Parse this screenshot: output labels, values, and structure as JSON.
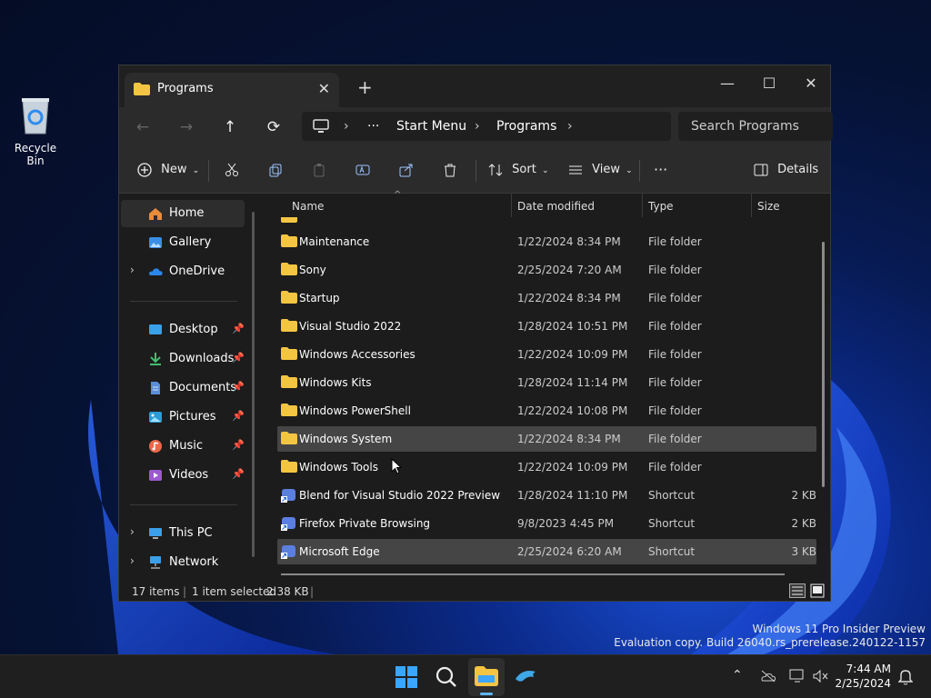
{
  "desktop": {
    "recycle_bin_label": "Recycle Bin",
    "watermark_line1": "Windows 11 Pro Insider Preview",
    "watermark_line2": "Evaluation copy. Build 26040.rs_prerelease.240122-1157"
  },
  "window": {
    "tab_title": "Programs",
    "tab_close": "✕",
    "new_tab": "+",
    "minimize": "—",
    "maximize": "☐",
    "close": "✕"
  },
  "nav": {
    "back": "←",
    "forward": "→",
    "up": "↑",
    "refresh": "⟳",
    "breadcrumb_more": "···",
    "breadcrumb": [
      "Start Menu",
      "Programs"
    ],
    "search_placeholder": "Search Programs"
  },
  "toolbar": {
    "new_label": "New",
    "sort_label": "Sort",
    "view_label": "View",
    "more_label": "···",
    "details_label": "Details"
  },
  "sidebar": {
    "items": [
      {
        "label": "Home",
        "icon": "home-icon"
      },
      {
        "label": "Gallery",
        "icon": "gallery-icon"
      },
      {
        "label": "OneDrive",
        "icon": "onedrive-icon"
      },
      {
        "label": "Desktop",
        "icon": "desktop-icon"
      },
      {
        "label": "Downloads",
        "icon": "downloads-icon"
      },
      {
        "label": "Documents",
        "icon": "documents-icon"
      },
      {
        "label": "Pictures",
        "icon": "pictures-icon"
      },
      {
        "label": "Music",
        "icon": "music-icon"
      },
      {
        "label": "Videos",
        "icon": "videos-icon"
      },
      {
        "label": "This PC",
        "icon": "this-pc-icon"
      },
      {
        "label": "Network",
        "icon": "network-icon"
      }
    ]
  },
  "columns": {
    "name": "Name",
    "date": "Date modified",
    "type": "Type",
    "size": "Size"
  },
  "files": [
    {
      "name": "Maintenance",
      "date": "1/22/2024 8:34 PM",
      "type": "File folder",
      "size": ""
    },
    {
      "name": "Sony",
      "date": "2/25/2024 7:20 AM",
      "type": "File folder",
      "size": ""
    },
    {
      "name": "Startup",
      "date": "1/22/2024 8:34 PM",
      "type": "File folder",
      "size": ""
    },
    {
      "name": "Visual Studio 2022",
      "date": "1/28/2024 10:51 PM",
      "type": "File folder",
      "size": ""
    },
    {
      "name": "Windows Accessories",
      "date": "1/22/2024 10:09 PM",
      "type": "File folder",
      "size": ""
    },
    {
      "name": "Windows Kits",
      "date": "1/28/2024 11:14 PM",
      "type": "File folder",
      "size": ""
    },
    {
      "name": "Windows PowerShell",
      "date": "1/22/2024 10:08 PM",
      "type": "File folder",
      "size": ""
    },
    {
      "name": "Windows System",
      "date": "1/22/2024 8:34 PM",
      "type": "File folder",
      "size": ""
    },
    {
      "name": "Windows Tools",
      "date": "1/22/2024 10:09 PM",
      "type": "File folder",
      "size": ""
    },
    {
      "name": "Blend for Visual Studio 2022 Preview",
      "date": "1/28/2024 11:10 PM",
      "type": "Shortcut",
      "size": "2 KB"
    },
    {
      "name": "Firefox Private Browsing",
      "date": "9/8/2023 4:45 PM",
      "type": "Shortcut",
      "size": "2 KB"
    },
    {
      "name": "Microsoft Edge",
      "date": "2/25/2024 6:20 AM",
      "type": "Shortcut",
      "size": "3 KB"
    }
  ],
  "status": {
    "items": "17 items",
    "selected": "1 item selected",
    "size": "2.38 KB"
  },
  "taskbar": {
    "time": "7:44 AM",
    "date": "2/25/2024"
  },
  "colors": {
    "folder": "#f4c542",
    "accent": "#0078d4",
    "selected_row": "#454545"
  }
}
